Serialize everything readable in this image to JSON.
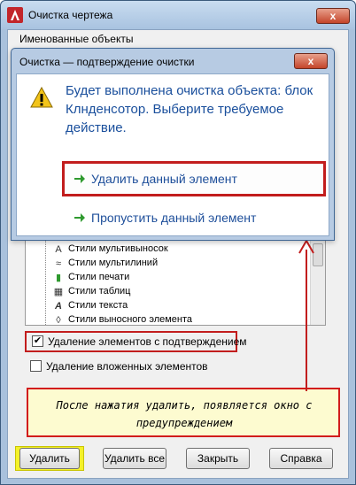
{
  "window": {
    "title": "Очистка чертежа",
    "close_glyph": "x",
    "named_objects_label": "Именованные объекты"
  },
  "tree": {
    "items": [
      {
        "label": "Стили мультивыносок",
        "icon": "multileader-style-icon",
        "glyph": "A"
      },
      {
        "label": "Стили мультилиний",
        "icon": "multiline-style-icon",
        "glyph": "≈"
      },
      {
        "label": "Стили печати",
        "icon": "plot-style-icon",
        "glyph": "▮"
      },
      {
        "label": "Стили таблиц",
        "icon": "table-style-icon",
        "glyph": "▦"
      },
      {
        "label": "Стили текста",
        "icon": "text-style-icon",
        "glyph": "A"
      },
      {
        "label": "Стили выносного элемента",
        "icon": "detail-style-icon",
        "glyph": "◊"
      }
    ]
  },
  "options": {
    "confirm_delete": {
      "label": "Удаление элементов с подтверждением",
      "checked": true,
      "check_glyph": "✔"
    },
    "nested": {
      "label": "Удаление вложенных элементов",
      "checked": false
    }
  },
  "buttons": {
    "delete": "Удалить",
    "delete_all": "Удалить все",
    "close": "Закрыть",
    "help": "Справка"
  },
  "callout": {
    "text": "После нажатия удалить, появляется окно с предупреждением"
  },
  "dialog": {
    "title": "Очистка — подтверждение очистки",
    "close_glyph": "x",
    "message": "Будет выполнена очистка объекта: блок Клнденсотор. Выберите требуемое действие.",
    "delete_item": "Удалить данный элемент",
    "skip_item": "Пропустить данный элемент"
  },
  "colors": {
    "accent_red": "#c21d1d",
    "link_blue": "#1d4e9a",
    "arrow_green": "#2f9a2f",
    "highlight_yellow": "#f4f12a"
  }
}
